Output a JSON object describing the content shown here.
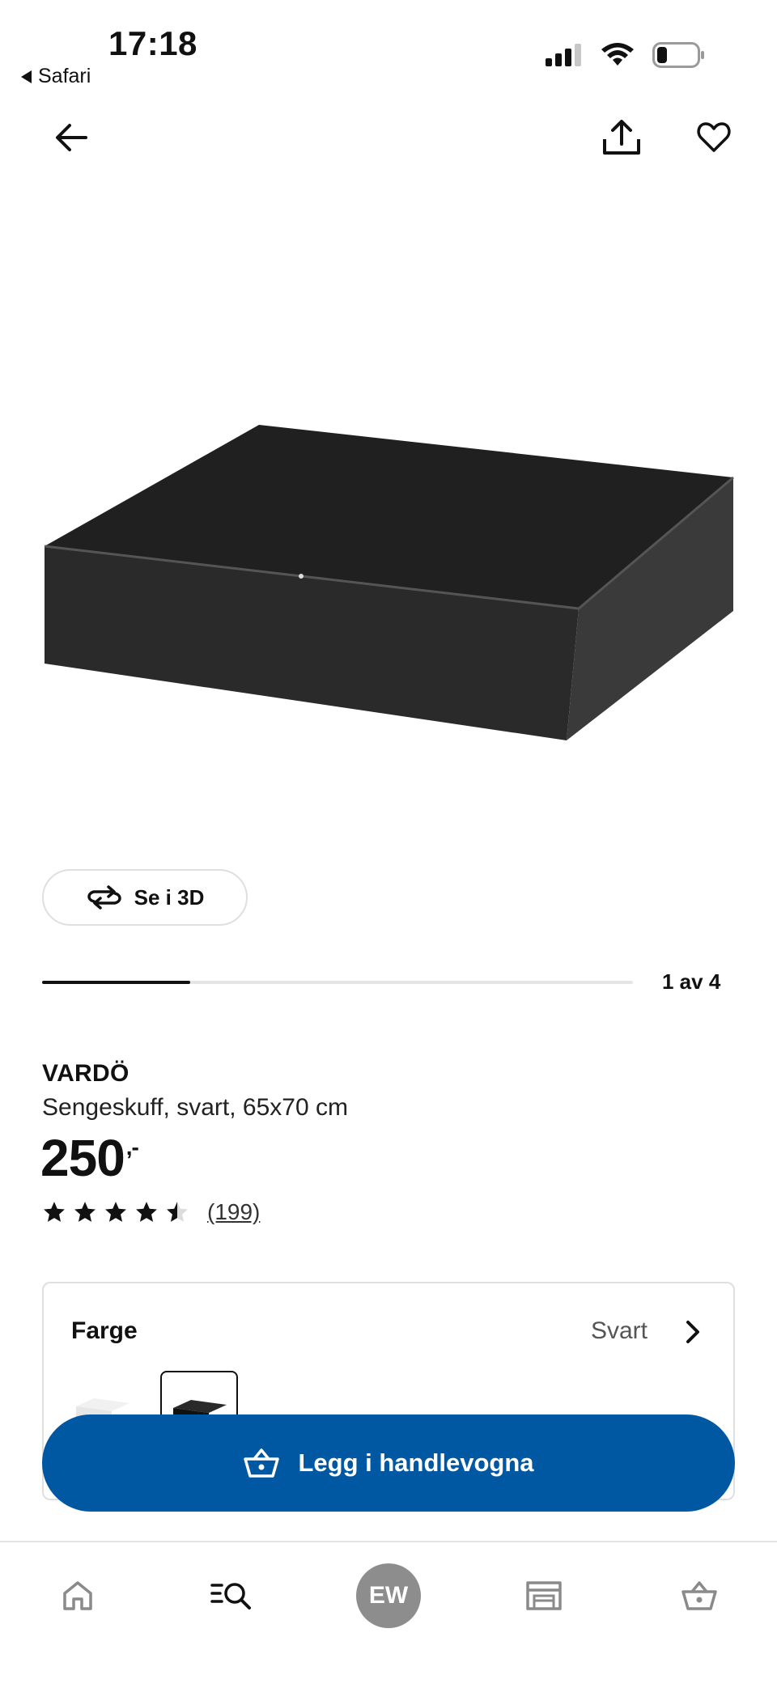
{
  "status_bar": {
    "time": "17:18",
    "back_app": "Safari"
  },
  "product": {
    "name": "VARDÖ",
    "description": "Sengeskuff, svart, 65x70 cm",
    "price": "250",
    "price_suffix": ",-",
    "rating": 4.5,
    "reviews": "(199)"
  },
  "gallery": {
    "view_3d_label": "Se i 3D",
    "counter": "1 av 4",
    "progress": 0.25
  },
  "color": {
    "label": "Farge",
    "value": "Svart"
  },
  "cta": {
    "label": "Legg i handlevogna"
  },
  "nav": {
    "avatar_initials": "EW"
  },
  "colors": {
    "primary": "#0058a3",
    "avatar": "#8d8d8d"
  },
  "icons": [
    "back-arrow-icon",
    "share-icon",
    "heart-icon",
    "rotate-3d-icon",
    "star-icon",
    "chevron-right-icon",
    "basket-icon",
    "home-icon",
    "search-icon",
    "store-icon"
  ]
}
